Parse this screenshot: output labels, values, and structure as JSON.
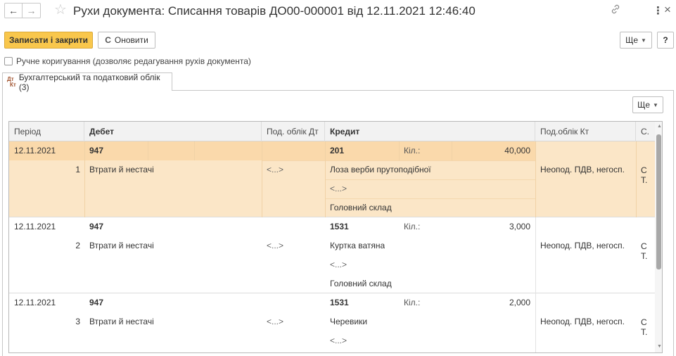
{
  "window": {
    "title": "Рухи документа: Списання товарів ДО00-000001 від 12.11.2021 12:46:40",
    "back_icon": "←",
    "forward_icon": "→",
    "star_icon": "☆",
    "link_icon": "🔗",
    "more_icon": "⋮",
    "close_icon": "×"
  },
  "toolbar": {
    "save_close_label": "Записати і закрити",
    "refresh_label": "Оновити",
    "refresh_icon": "C",
    "more_label": "Ще",
    "help_label": "?"
  },
  "manual_edit": {
    "label": "Ручне коригування (дозволяє редагування рухів документа)",
    "checked": false
  },
  "tab": {
    "icon_top": "Дт",
    "icon_bottom": "Кт",
    "label": "Бухгалтерський та податковий облік (3)"
  },
  "grid_toolbar": {
    "more_label": "Ще"
  },
  "table": {
    "columns": {
      "period": "Період",
      "debit": "Дебет",
      "tax_dt": "Под. облік Дт",
      "credit": "Кредит",
      "tax_kt": "Под.облік Кт",
      "c": "С."
    },
    "rows": [
      {
        "period": "12.11.2021",
        "num": "1",
        "debit_account": "947",
        "debit_sub1": "Втрати й нестачі",
        "tax_dt": "<...>",
        "credit_account": "201",
        "qty_label": "Кіл.:",
        "qty": "40,000",
        "credit_sub1": "Лоза верби прутоподібної",
        "credit_sub2": "<...>",
        "credit_sub3": "Головний склад",
        "tax_kt": "Неопод. ПДВ, негосп.",
        "c1": "С",
        "c2": "Т."
      },
      {
        "period": "12.11.2021",
        "num": "2",
        "debit_account": "947",
        "debit_sub1": "Втрати й нестачі",
        "tax_dt": "<...>",
        "credit_account": "1531",
        "qty_label": "Кіл.:",
        "qty": "3,000",
        "credit_sub1": "Куртка ватяна",
        "credit_sub2": "<...>",
        "credit_sub3": "Головний склад",
        "tax_kt": "Неопод. ПДВ, негосп.",
        "c1": "С",
        "c2": "Т."
      },
      {
        "period": "12.11.2021",
        "num": "3",
        "debit_account": "947",
        "debit_sub1": "Втрати й нестачі",
        "tax_dt": "<...>",
        "credit_account": "1531",
        "qty_label": "Кіл.:",
        "qty": "2,000",
        "credit_sub1": "Черевики",
        "credit_sub2": "<...>",
        "credit_sub3": "",
        "tax_kt": "Неопод. ПДВ, негосп.",
        "c1": "С",
        "c2": "Т."
      }
    ]
  },
  "colors": {
    "primary_button": "#f9c74c",
    "selected_row": "#fbe6c7",
    "selected_row_line": "#fad9ab"
  }
}
